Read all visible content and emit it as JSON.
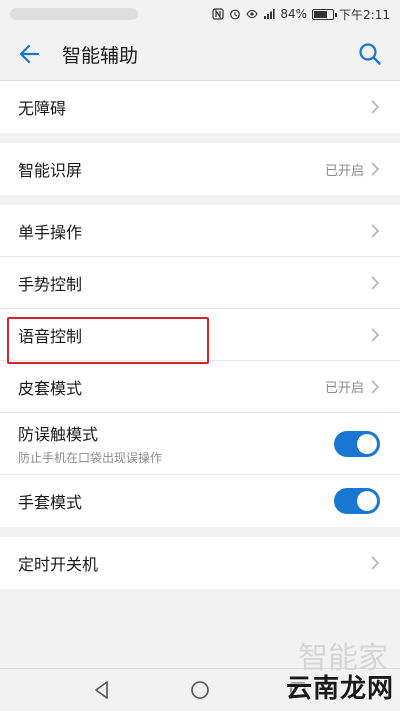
{
  "status_bar": {
    "battery_text": "84%",
    "time": "下午2:11",
    "battery_level": 0.84,
    "icons": [
      "nfc-icon",
      "alarm-icon",
      "eye-icon",
      "signal-icon",
      "battery-icon"
    ]
  },
  "header": {
    "title": "智能辅助",
    "back_icon": "arrow-left-icon",
    "search_icon": "search-icon"
  },
  "groups": [
    {
      "rows": [
        {
          "label": "无障碍"
        }
      ]
    },
    {
      "rows": [
        {
          "label": "智能识屏",
          "value": "已开启"
        }
      ]
    },
    {
      "rows": [
        {
          "label": "单手操作"
        },
        {
          "label": "手势控制"
        },
        {
          "label": "语音控制"
        },
        {
          "label": "皮套模式",
          "value": "已开启"
        },
        {
          "label": "防误触模式",
          "sublabel": "防止手机在口袋出现误操作",
          "toggle": true
        },
        {
          "label": "手套模式",
          "toggle": true
        }
      ]
    },
    {
      "rows": [
        {
          "label": "定时开关机"
        }
      ]
    }
  ],
  "navbar": {
    "icons": [
      "back-triangle-icon",
      "home-circle-icon",
      "recents-square-icon"
    ]
  },
  "watermark": {
    "text": "云南龙网",
    "faint_text": "智能家"
  },
  "colors": {
    "accent": "#1976d2",
    "highlight": "#d0262e",
    "background": "#f2f2f2"
  }
}
